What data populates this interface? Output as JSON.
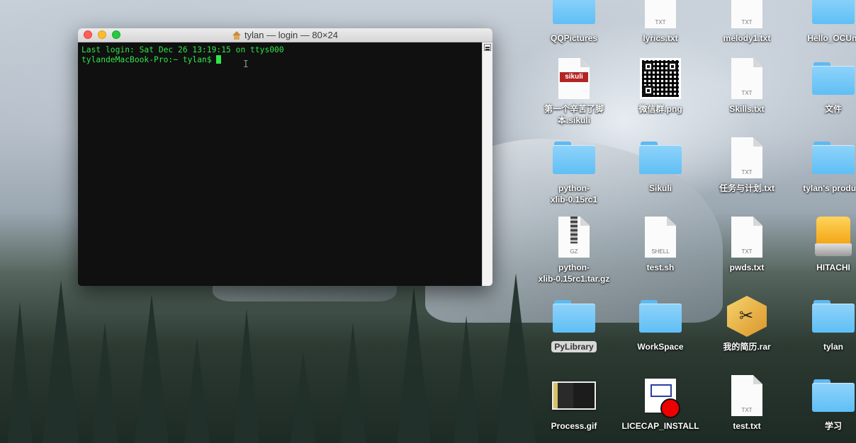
{
  "terminal": {
    "title": "tylan — login — 80×24",
    "lines": [
      "Last login: Sat Dec 26 13:19:15 on ttys000",
      "tylandeMacBook-Pro:~ tylan$ "
    ]
  },
  "desktop": {
    "icons": [
      {
        "label": "QQPictures",
        "kind": "folder"
      },
      {
        "label": "lyrics.txt",
        "kind": "txt"
      },
      {
        "label": "melody1.txt",
        "kind": "txt"
      },
      {
        "label": "Hello_OCUni",
        "kind": "folder"
      },
      {
        "label": "第一个辛苦了脚\n本.sikuli",
        "kind": "sikuli",
        "badge": "sikuli"
      },
      {
        "label": "微信群.png",
        "kind": "qr-image"
      },
      {
        "label": "Skills.txt",
        "kind": "txt"
      },
      {
        "label": "文件",
        "kind": "folder"
      },
      {
        "label": "python-\nxlib-0.15rc1",
        "kind": "folder"
      },
      {
        "label": "Sikuli",
        "kind": "folder"
      },
      {
        "label": "任务与计划.txt",
        "kind": "txt"
      },
      {
        "label": "tylan's product",
        "kind": "folder"
      },
      {
        "label": "python-\nxlib-0.15rc1.tar.gz",
        "kind": "gz"
      },
      {
        "label": "test.sh",
        "kind": "shell"
      },
      {
        "label": "pwds.txt",
        "kind": "txt"
      },
      {
        "label": "HITACHI",
        "kind": "drive"
      },
      {
        "label": "PyLibrary",
        "kind": "folder",
        "selected": true
      },
      {
        "label": "WorkSpace",
        "kind": "folder"
      },
      {
        "label": "我的简历.rar",
        "kind": "archive"
      },
      {
        "label": "tylan",
        "kind": "folder"
      },
      {
        "label": "Process.gif",
        "kind": "gif"
      },
      {
        "label": "LICECAP_INSTALL",
        "kind": "app"
      },
      {
        "label": "test.txt",
        "kind": "txt"
      },
      {
        "label": "学习",
        "kind": "folder"
      }
    ],
    "ext_labels": {
      "txt": "TXT",
      "gz": "GZ",
      "shell": "SHELL"
    }
  }
}
